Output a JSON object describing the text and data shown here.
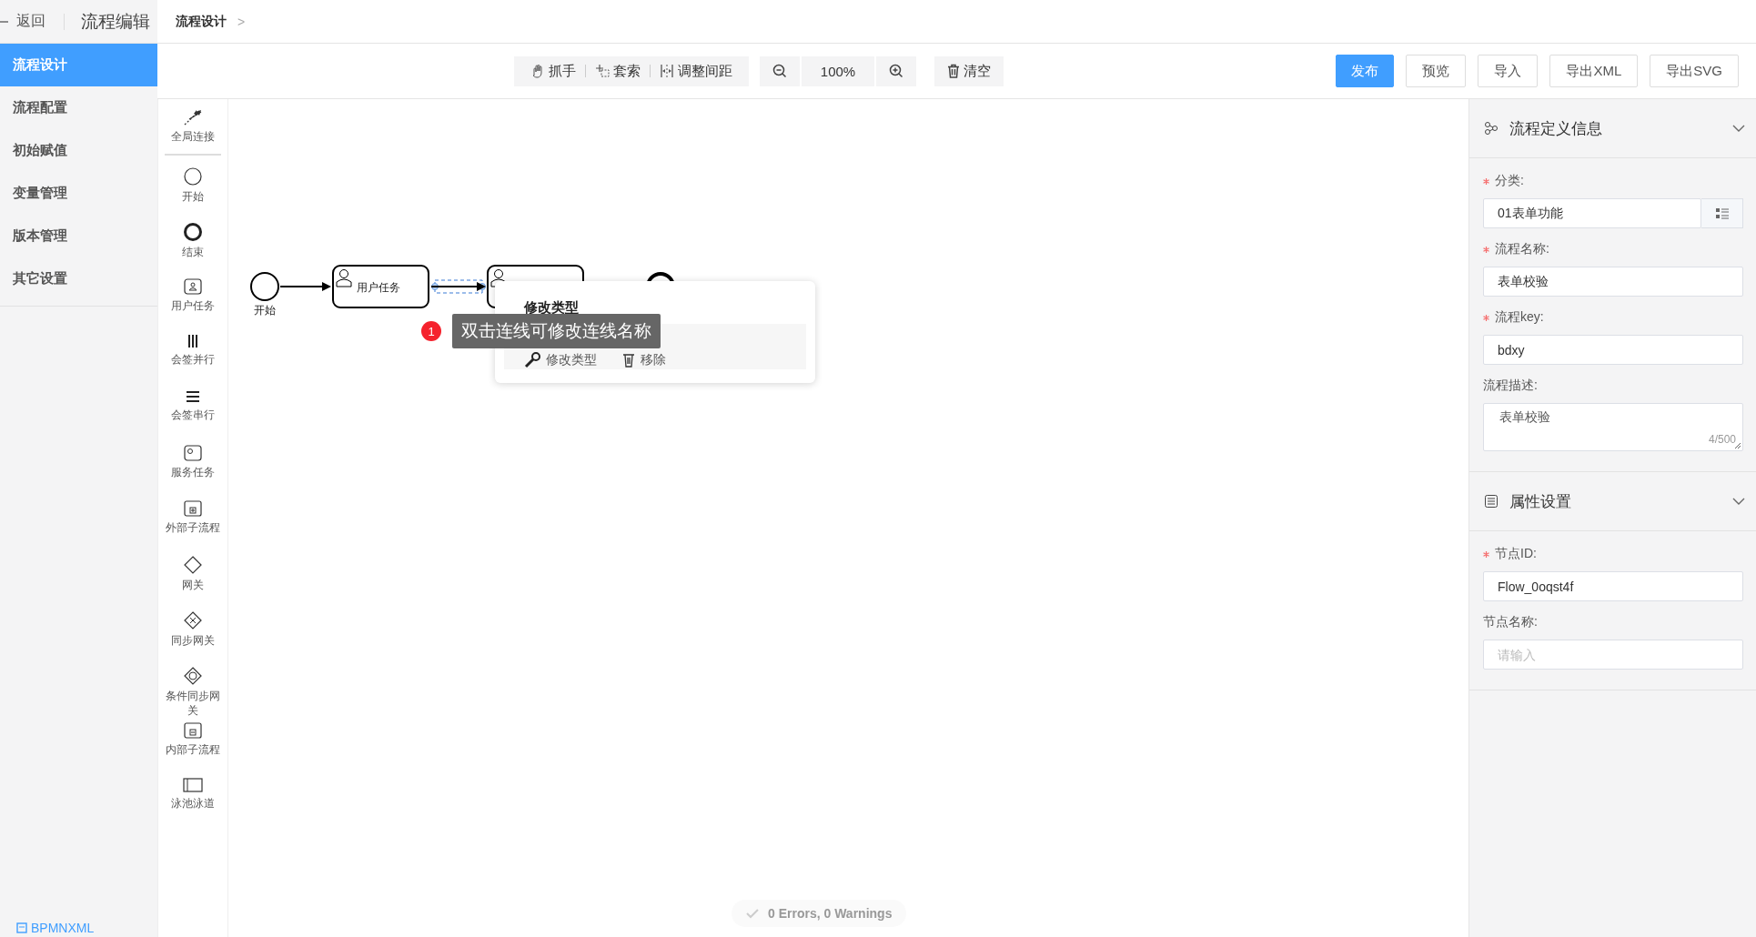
{
  "header": {
    "back": "返回",
    "title": "流程编辑",
    "breadcrumb": "流程设计",
    "breadcrumb_separator": ">"
  },
  "nav": [
    {
      "label": "流程设计",
      "selected": true
    },
    {
      "label": "流程配置",
      "selected": false
    },
    {
      "label": "初始赋值",
      "selected": false
    },
    {
      "label": "变量管理",
      "selected": false
    },
    {
      "label": "版本管理",
      "selected": false
    },
    {
      "label": "其它设置",
      "selected": false
    }
  ],
  "bottom_link": "BPMNXML",
  "toolbar": {
    "tools": [
      {
        "kind": "hand",
        "label": "抓手"
      },
      {
        "kind": "lasso",
        "label": "套索"
      },
      {
        "kind": "space",
        "label": "调整间距"
      }
    ],
    "zoom": "100%",
    "clear": "清空",
    "actions": [
      {
        "kind": "primary",
        "label": "发布"
      },
      {
        "kind": "default",
        "label": "预览"
      },
      {
        "kind": "default",
        "label": "导入"
      },
      {
        "kind": "default",
        "label": "导出XML"
      },
      {
        "kind": "default",
        "label": "导出SVG"
      }
    ]
  },
  "palette": [
    {
      "kind": "connect",
      "label": "全局连接"
    },
    {
      "kind": "start",
      "label": "开始"
    },
    {
      "kind": "end",
      "label": "结束"
    },
    {
      "kind": "user_task",
      "label": "用户任务"
    },
    {
      "kind": "parallel",
      "label": "会签并行"
    },
    {
      "kind": "sequential",
      "label": "会签串行"
    },
    {
      "kind": "service",
      "label": "服务任务"
    },
    {
      "kind": "call_activity",
      "label": "外部子流程"
    },
    {
      "kind": "gateway",
      "label": "网关"
    },
    {
      "kind": "parallel_gateway",
      "label": "同步网关"
    },
    {
      "kind": "inclusive_gateway",
      "label": "条件同步网关"
    },
    {
      "kind": "subprocess",
      "label": "内部子流程"
    },
    {
      "kind": "pool",
      "label": "泳池泳道"
    }
  ],
  "diagram": {
    "nodes": [
      {
        "kind": "start",
        "label": "开始"
      },
      {
        "kind": "user_task",
        "label": "用户任务"
      },
      {
        "kind": "user_task"
      },
      {
        "kind": "end"
      }
    ],
    "edges": [
      {
        "selected": false
      },
      {
        "selected": true
      }
    ]
  },
  "context_menu": {
    "title": "修改类型",
    "items": [
      {
        "kind": "wrench",
        "label": "修改类型"
      },
      {
        "kind": "trash",
        "label": "移除"
      }
    ]
  },
  "tooltip": {
    "badge": "1",
    "text": "双击连线可修改连线名称"
  },
  "status": "0 Errors, 0 Warnings",
  "panel": {
    "sections": [
      {
        "kind": "definition",
        "title": "流程定义信息",
        "expanded": true,
        "fields": [
          {
            "kind": "select",
            "label": "分类:",
            "required": true,
            "value": "01表单功能"
          },
          {
            "kind": "input",
            "label": "流程名称:",
            "required": true,
            "value": "表单校验"
          },
          {
            "kind": "input",
            "label": "流程key:",
            "required": true,
            "value": "bdxy"
          },
          {
            "kind": "textarea",
            "label": "流程描述:",
            "required": false,
            "value": "表单校验",
            "count": "4/500"
          }
        ]
      },
      {
        "kind": "properties",
        "title": "属性设置",
        "expanded": true,
        "fields": [
          {
            "kind": "input",
            "label": "节点ID:",
            "required": true,
            "value": "Flow_0oqst4f"
          },
          {
            "kind": "input",
            "label": "节点名称:",
            "required": false,
            "placeholder": "请输入"
          }
        ]
      }
    ]
  }
}
